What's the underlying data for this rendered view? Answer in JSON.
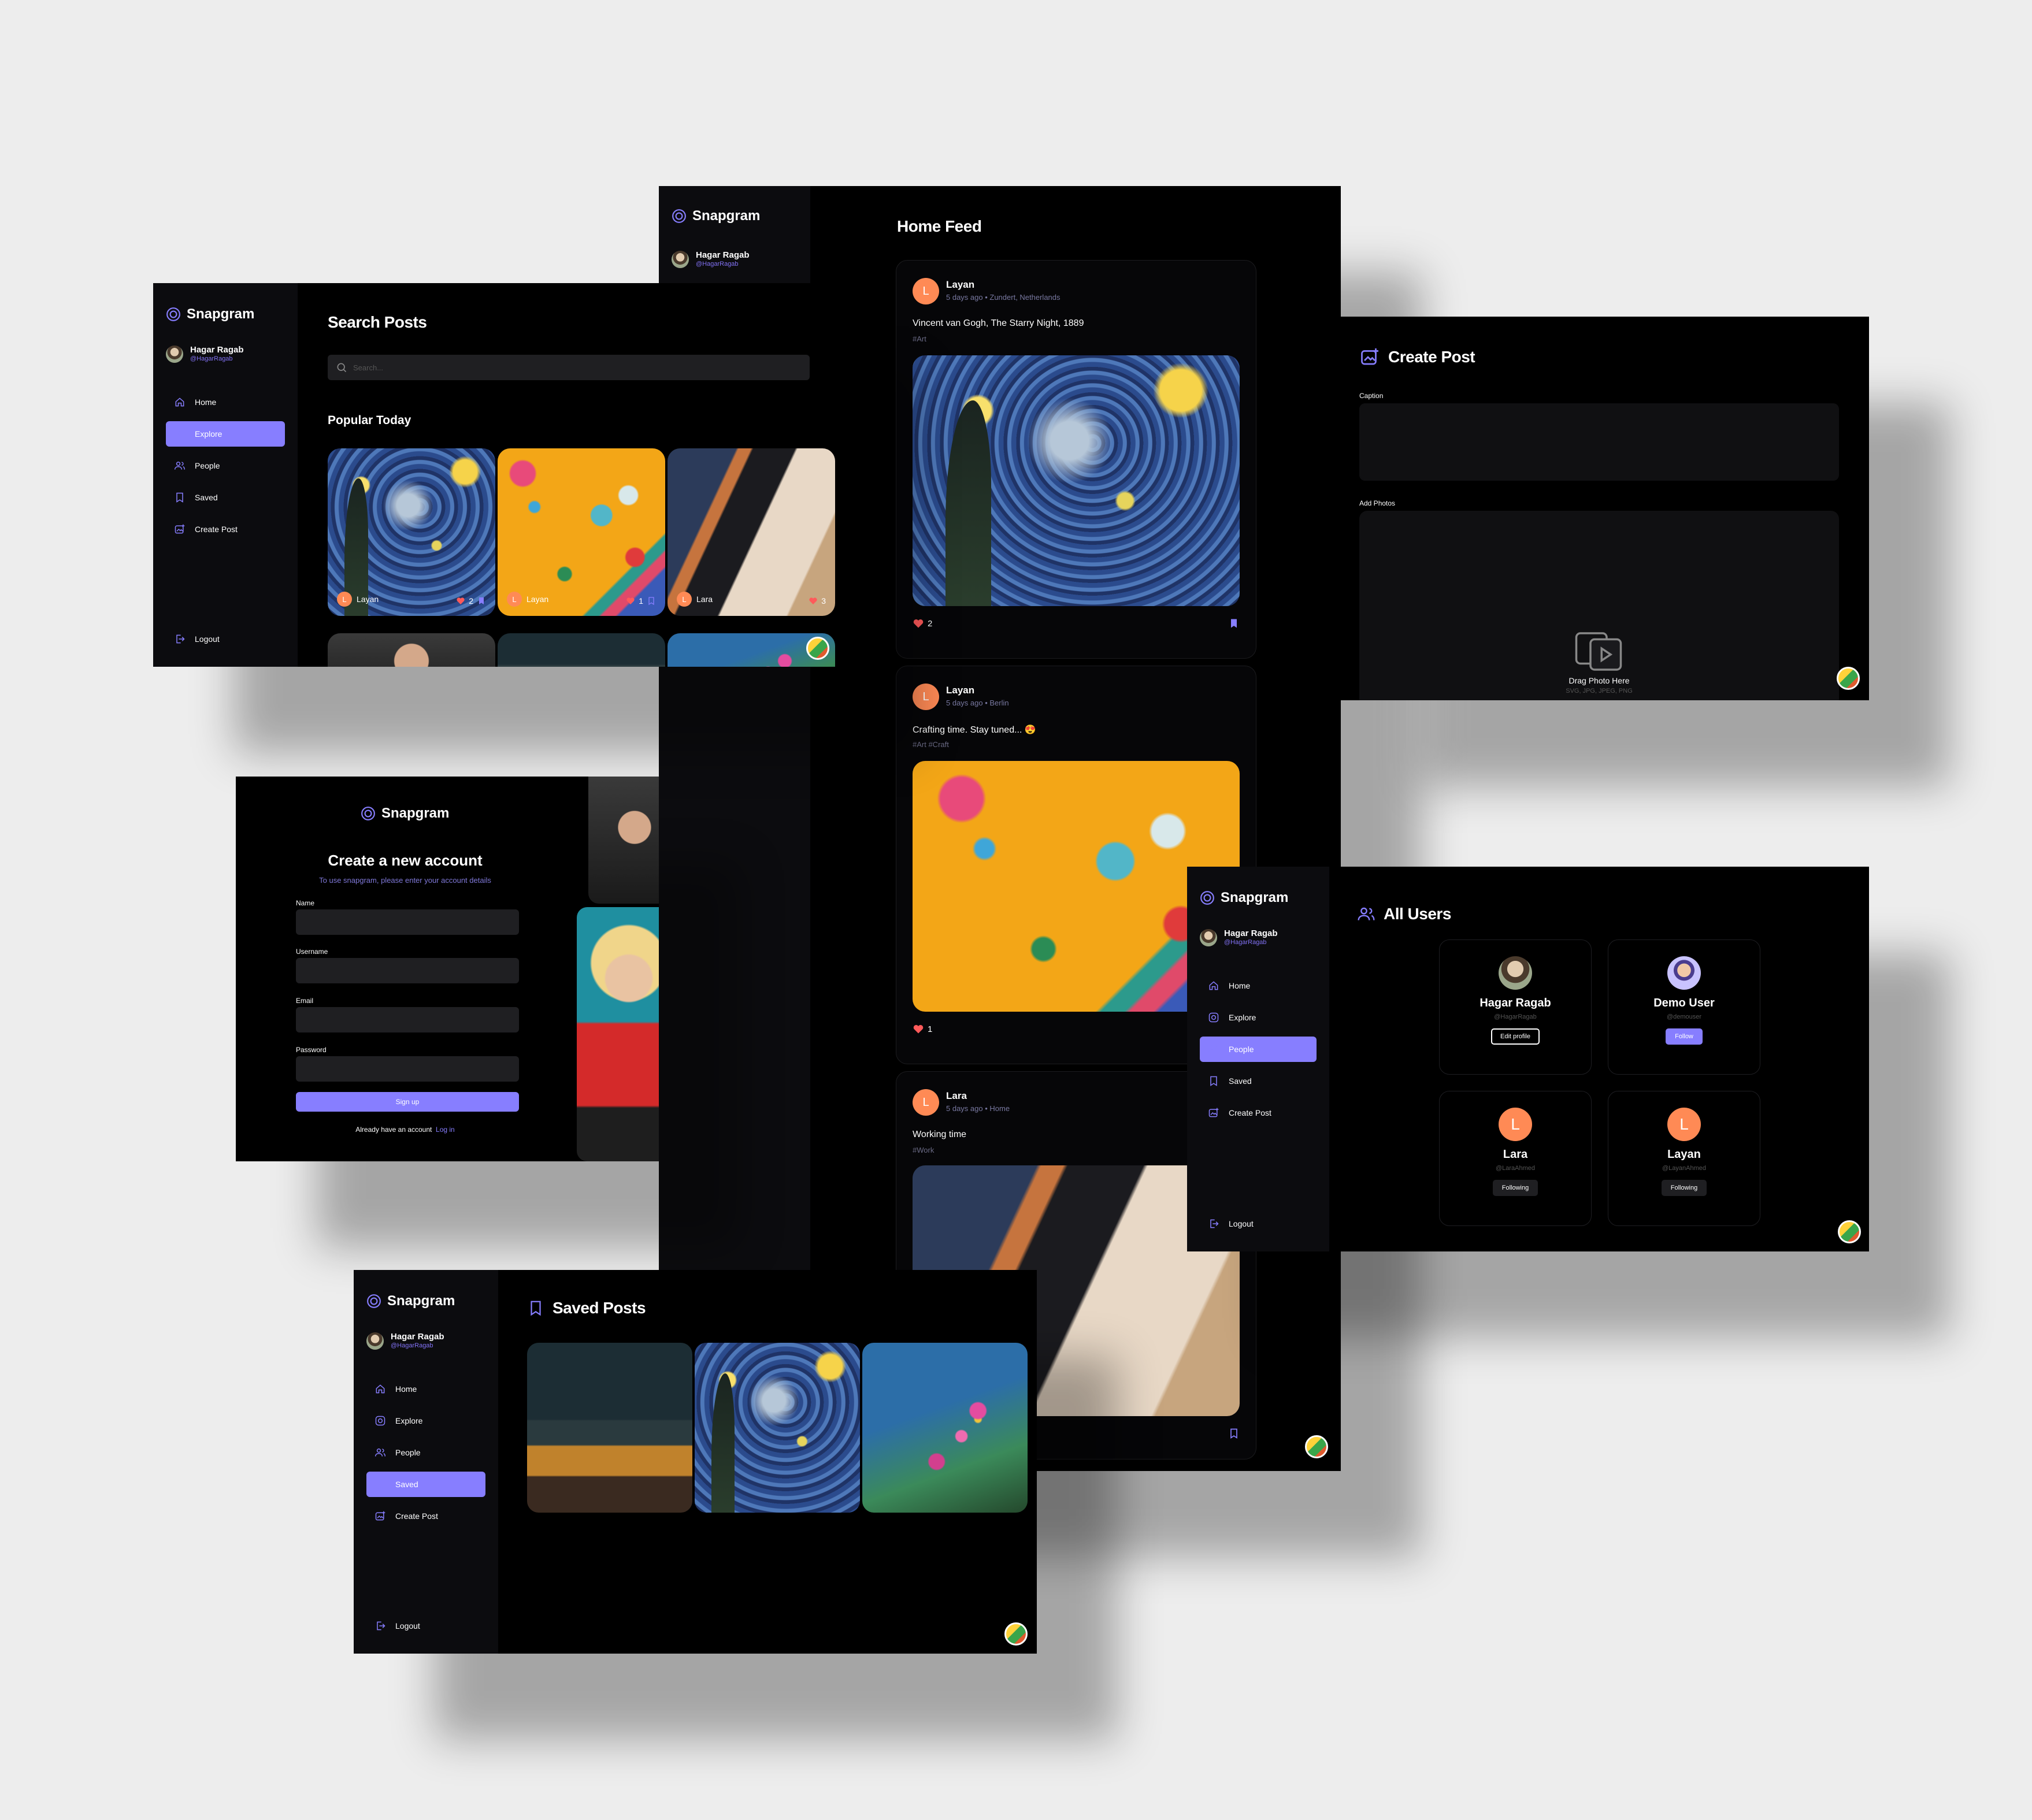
{
  "brand": "Snapgram",
  "user": {
    "name": "Hagar Ragab",
    "handle": "@HagarRagab"
  },
  "nav": {
    "home": "Home",
    "explore": "Explore",
    "people": "People",
    "saved": "Saved",
    "create": "Create Post",
    "logout": "Logout"
  },
  "explore": {
    "title": "Search Posts",
    "placeholder": "Search...",
    "popular": "Popular Today",
    "tiles": [
      {
        "name": "Layan",
        "likes": "2"
      },
      {
        "name": "Layan",
        "likes": "1"
      },
      {
        "name": "Lara",
        "likes": "3"
      }
    ]
  },
  "feed": {
    "title": "Home Feed",
    "posts": [
      {
        "author": "Layan",
        "time": "5 days ago",
        "location": "Zundert, Netherlands",
        "caption": "Vincent van Gogh, The Starry Night, 1889",
        "tags": "#Art",
        "likes": "2"
      },
      {
        "author": "Layan",
        "time": "5 days ago",
        "location": "Berlin",
        "caption": "Crafting time. Stay tuned... 😍",
        "tags": "#Art #Craft",
        "likes": "1"
      },
      {
        "author": "Lara",
        "time": "5 days ago",
        "location": "Home",
        "caption": "Working time",
        "tags": "#Work",
        "likes": ""
      }
    ]
  },
  "create": {
    "title": "Create Post",
    "caption_label": "Caption",
    "photos_label": "Add Photos",
    "drag": "Drag Photo Here",
    "formats": "SVG, JPG, JPEG, PNG"
  },
  "signup": {
    "title": "Create a new account",
    "subtitle": "To use snapgram, please enter your account details",
    "name": "Name",
    "username": "Username",
    "email": "Email",
    "password": "Password",
    "button": "Sign up",
    "have": "Already have an account",
    "login": "Log in"
  },
  "people": {
    "title": "All Users",
    "users": [
      {
        "name": "Hagar Ragab",
        "handle": "@HagarRagab",
        "action": "Edit profile"
      },
      {
        "name": "Demo User",
        "handle": "@demouser",
        "action": "Follow"
      },
      {
        "name": "Lara",
        "handle": "@LaraAhmed",
        "action": "Following",
        "initial": "L"
      },
      {
        "name": "Layan",
        "handle": "@LayanAhmed",
        "action": "Following",
        "initial": "L"
      }
    ]
  },
  "saved": {
    "title": "Saved Posts"
  },
  "colors": {
    "accent": "#877eff",
    "bg": "#000000",
    "sidebar": "#0c0c0f",
    "avatar_orange": "#ff8a55"
  }
}
